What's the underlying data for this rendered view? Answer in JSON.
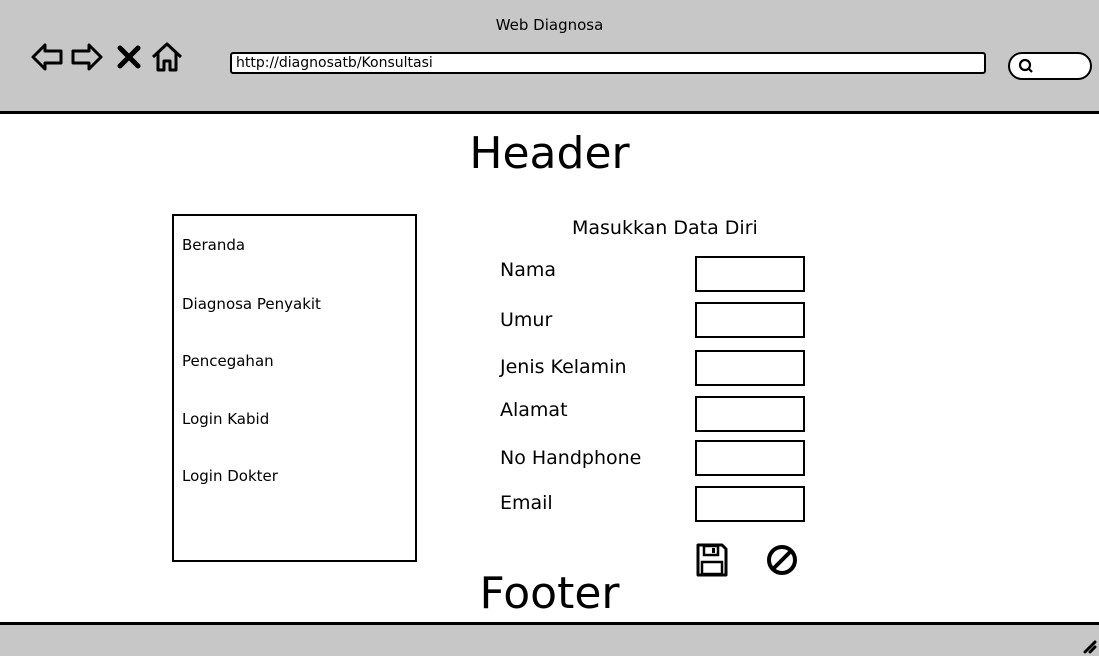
{
  "window": {
    "title": "Web Diagnosa"
  },
  "browser": {
    "url": "http://diagnosatb/Konsultasi",
    "back_icon": "arrow-left-icon",
    "forward_icon": "arrow-right-icon",
    "stop_icon": "close-icon",
    "home_icon": "home-icon",
    "search_icon": "search-icon"
  },
  "page": {
    "header": "Header",
    "footer": "Footer"
  },
  "sidebar": {
    "items": [
      {
        "label": "Beranda"
      },
      {
        "label": "Diagnosa Penyakit"
      },
      {
        "label": "Pencegahan"
      },
      {
        "label": "Login Kabid"
      },
      {
        "label": "Login Dokter"
      }
    ]
  },
  "form": {
    "title": "Masukkan Data Diri",
    "fields": [
      {
        "label": "Nama",
        "value": ""
      },
      {
        "label": "Umur",
        "value": ""
      },
      {
        "label": "Jenis Kelamin",
        "value": ""
      },
      {
        "label": "Alamat",
        "value": ""
      },
      {
        "label": "No Handphone",
        "value": ""
      },
      {
        "label": "Email",
        "value": ""
      }
    ],
    "save_icon": "save-icon",
    "cancel_icon": "cancel-icon"
  },
  "colors": {
    "chrome": "#c7c7c7",
    "border": "#000000",
    "background": "#ffffff"
  }
}
